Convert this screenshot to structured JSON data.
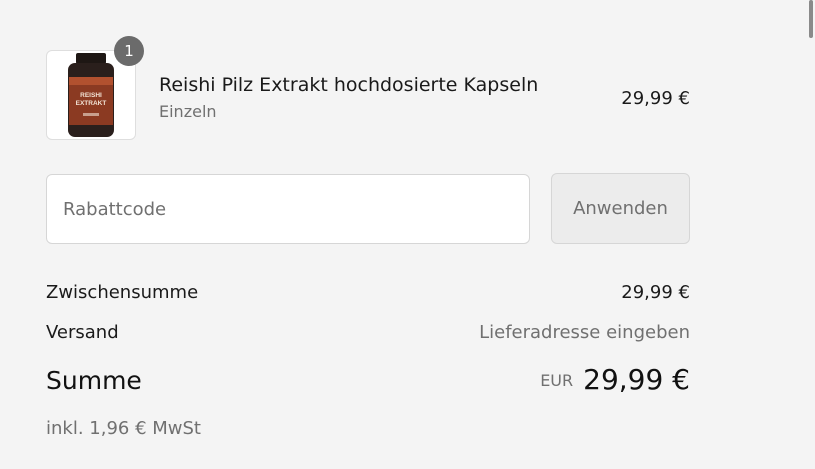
{
  "product": {
    "name": "Reishi Pilz Extrakt hochdosierte Kapseln",
    "variant": "Einzeln",
    "price": "29,99 €",
    "quantity": "1",
    "image_label": "REISHI EXTRAKT",
    "image_icon": "supplement-bottle-icon"
  },
  "discount": {
    "placeholder": "Rabattcode",
    "value": "",
    "apply_label": "Anwenden"
  },
  "summary": {
    "subtotal_label": "Zwischensumme",
    "subtotal_value": "29,99 €",
    "shipping_label": "Versand",
    "shipping_value": "Lieferadresse eingeben",
    "total_label": "Summe",
    "currency": "EUR",
    "total_value": "29,99 €",
    "tax_note": "inkl. 1,96 € MwSt"
  },
  "colors": {
    "background": "#f4f4f4",
    "badge": "#6b6b6b",
    "muted_text": "#707070",
    "bottle": "#2a1f1c",
    "label": "#8b3a22"
  }
}
